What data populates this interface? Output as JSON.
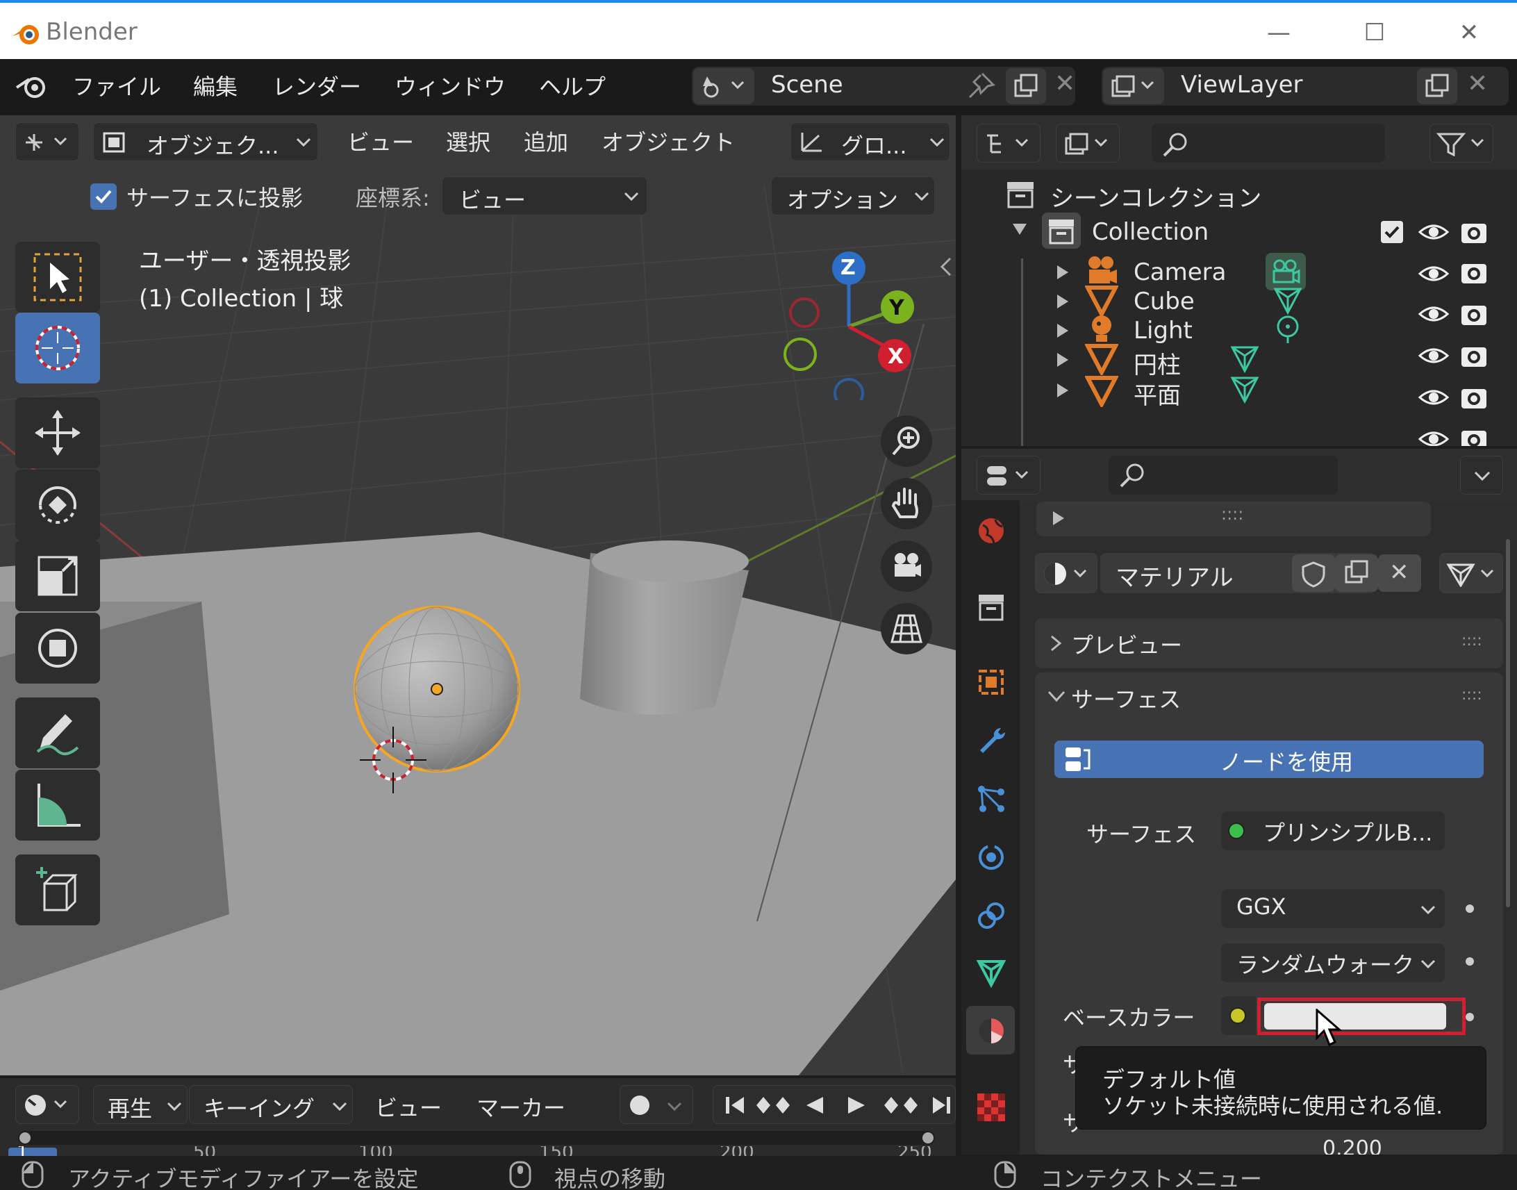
{
  "window": {
    "title": "Blender",
    "minimize": "—",
    "maximize": "☐",
    "close": "✕"
  },
  "menu": {
    "items": [
      "ファイル",
      "編集",
      "レンダー",
      "ウィンドウ",
      "ヘルプ"
    ]
  },
  "scene": {
    "name": "Scene"
  },
  "view_layer": {
    "name": "ViewLayer"
  },
  "viewport": {
    "header": {
      "mode": "オブジェク...",
      "menu": [
        "ビュー",
        "選択",
        "追加",
        "オブジェクト"
      ],
      "transform": "グロ..."
    },
    "subheader": {
      "snap_label": "サーフェスに投影",
      "snap_checked": true,
      "coord_label": "座標系:",
      "coord_value": "ビュー",
      "options": "オプション"
    },
    "overlay_text": {
      "line1": "ユーザー・透視投影",
      "line2": "(1) Collection | 球"
    },
    "gizmo": {
      "z": "Z",
      "y": "Y",
      "x": "X"
    }
  },
  "outliner": {
    "root": "シーンコレクション",
    "collection": "Collection",
    "items": [
      "Camera",
      "Cube",
      "Light",
      "円柱",
      "平面"
    ]
  },
  "properties": {
    "material_name": "マテリアル",
    "sections": {
      "preview": "プレビュー",
      "surface": "サーフェス"
    },
    "use_nodes": "ノードを使用",
    "surface_label": "サーフェス",
    "surface_value": "プリンシプルB...",
    "distribution": "GGX",
    "subsurface_method": "ランダムウォーク",
    "base_color_label": "ベースカラー",
    "base_color": "#e8e8e8",
    "grip": "::::",
    "partial_label_1": "サ",
    "partial_label_2": "サ",
    "partial_value": "0.200"
  },
  "tooltip": {
    "title": "デフォルト値",
    "description": "ソケット未接続時に使用される値."
  },
  "timeline": {
    "playback": "再生",
    "keying": "キーイング",
    "view": "ビュー",
    "marker": "マーカー",
    "ticks": [
      "1",
      "50",
      "100",
      "150",
      "200",
      "250"
    ]
  },
  "statusbar": {
    "left": "アクティブモディファイアーを設定",
    "middle": "視点の移動",
    "right": "コンテクストメニュー"
  },
  "colors": {
    "accent": "#4772b3",
    "selection_orange": "#f5a623",
    "highlight_red": "#d01f2e"
  }
}
